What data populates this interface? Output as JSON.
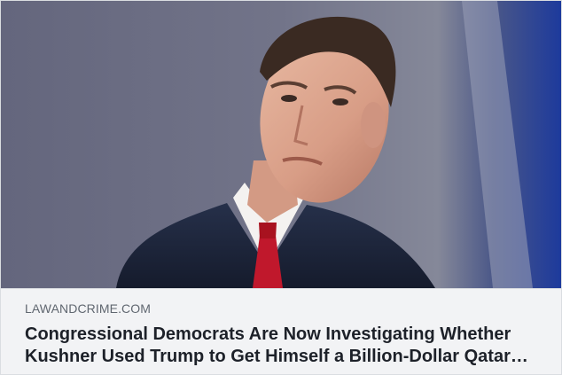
{
  "link_preview": {
    "domain": "LAWANDCRIME.COM",
    "headline": "Congressional Democrats Are Now Investigating Whether Kushner Used Trump to Get Himself a Billion-Dollar Qatar Bailout",
    "image_alt": "Jared Kushner at a White House press briefing"
  },
  "colors": {
    "meta_background": "#f2f3f5",
    "domain_text": "#606770",
    "headline_text": "#1d2129",
    "border": "#dadde1"
  }
}
